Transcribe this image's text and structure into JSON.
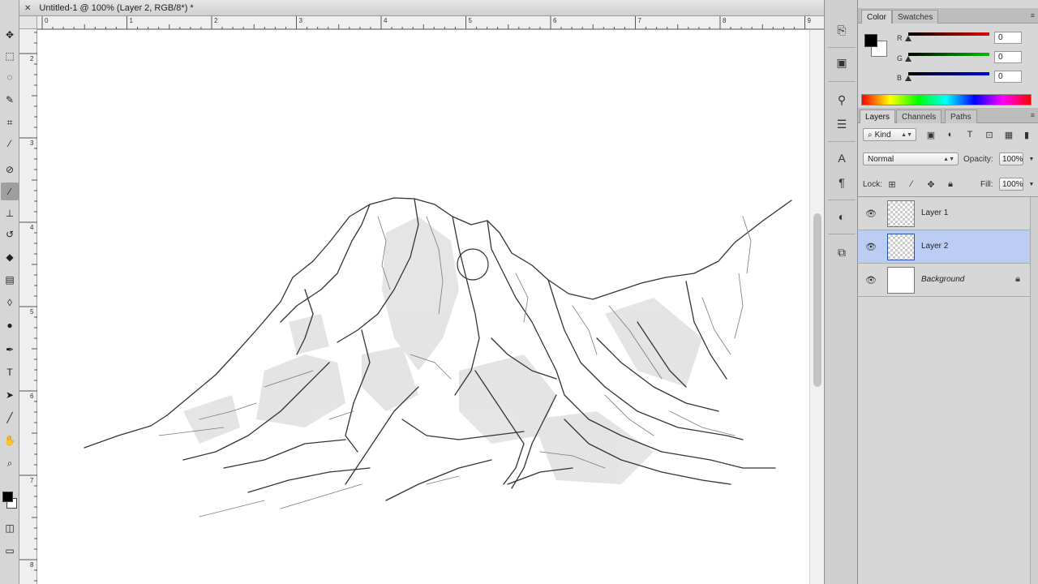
{
  "document": {
    "tab_title": "Untitled-1 @ 100% (Layer 2, RGB/8*) *",
    "ruler_top_numbers": [
      "0",
      "1",
      "2",
      "3",
      "4",
      "5",
      "6",
      "7",
      "8",
      "9"
    ],
    "ruler_left_numbers": [
      "2",
      "3",
      "4",
      "5",
      "6",
      "7",
      "8"
    ]
  },
  "tools": {
    "icons": [
      "move-icon",
      "marquee-icon",
      "lasso-icon",
      "quick-selection-icon",
      "crop-icon",
      "eyedropper-icon",
      "healing-brush-icon",
      "brush-icon",
      "clone-stamp-icon",
      "history-brush-icon",
      "eraser-icon",
      "gradient-icon",
      "blur-icon",
      "dodge-icon",
      "pen-icon",
      "type-icon",
      "path-selection-icon",
      "line-shape-icon",
      "hand-icon",
      "zoom-icon"
    ],
    "active": "brush-icon",
    "foreground": "#000000",
    "background": "#ffffff"
  },
  "color_panel": {
    "tabs": [
      "Color",
      "Swatches"
    ],
    "active_tab": "Color",
    "channels": [
      {
        "label": "R",
        "value": "0",
        "color": "#e00000"
      },
      {
        "label": "G",
        "value": "0",
        "color": "#00c000"
      },
      {
        "label": "B",
        "value": "0",
        "color": "#0000e0"
      }
    ]
  },
  "layers_panel": {
    "tabs": [
      "Layers",
      "Channels",
      "Paths"
    ],
    "active_tab": "Layers",
    "filter": "Kind",
    "blend_mode": "Normal",
    "opacity_label": "Opacity:",
    "opacity": "100%",
    "lock_label": "Lock:",
    "fill_label": "Fill:",
    "fill": "100%",
    "layers": [
      {
        "name": "Layer 1",
        "visible": true,
        "selected": false,
        "locked": false
      },
      {
        "name": "Layer 2",
        "visible": true,
        "selected": true,
        "locked": false
      },
      {
        "name": "Background",
        "visible": true,
        "selected": false,
        "locked": true
      }
    ]
  },
  "colors": {
    "selection": "#bccdf4",
    "panel_bg": "#d7d7d7"
  }
}
